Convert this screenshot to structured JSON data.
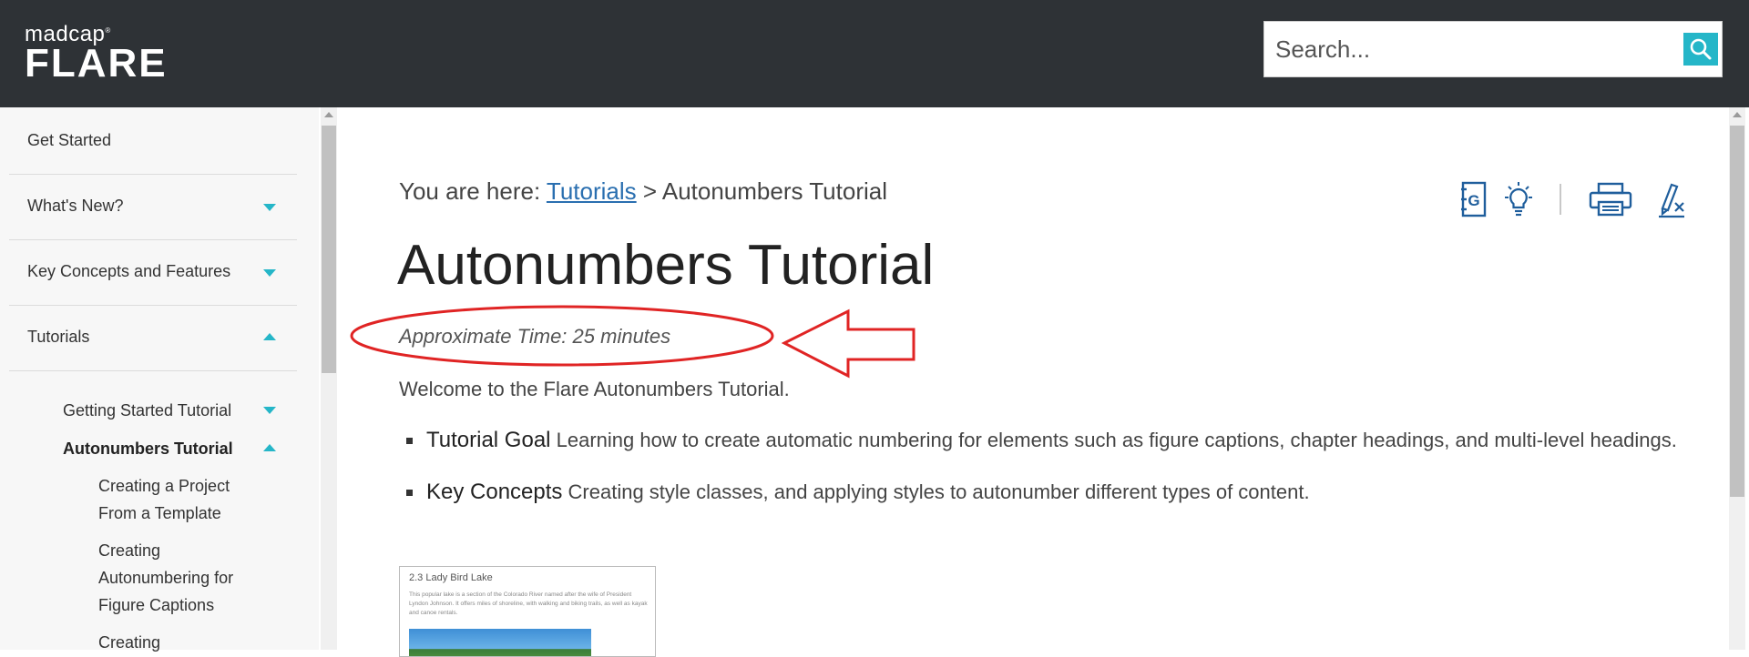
{
  "header": {
    "logo_top": "madcap",
    "logo_reg": "®",
    "logo_bottom": "FLARE",
    "search_placeholder": "Search..."
  },
  "sidebar": {
    "items": [
      {
        "label": "Get Started",
        "expandable": false
      },
      {
        "label": "What's New?",
        "expandable": true,
        "expanded": false
      },
      {
        "label": "Key Concepts and Features",
        "expandable": true,
        "expanded": false
      },
      {
        "label": "Tutorials",
        "expandable": true,
        "expanded": true
      }
    ],
    "subitems": [
      {
        "label": "Getting Started Tutorial",
        "expanded": false
      },
      {
        "label": "Autonumbers Tutorial",
        "expanded": true,
        "active": true
      }
    ],
    "subsubitems": [
      {
        "label_line1": "Creating a Project",
        "label_line2": "From a Template"
      },
      {
        "label_line1": "Creating",
        "label_line2": "Autonumbering for",
        "label_line3": "Figure Captions"
      },
      {
        "label_line1": "Creating"
      }
    ]
  },
  "breadcrumb": {
    "prefix": "You are here: ",
    "link": "Tutorials",
    "separator": " > ",
    "current": "Autonumbers Tutorial"
  },
  "page": {
    "title": "Autonumbers Tutorial",
    "approx_time": "Approximate Time: 25 minutes",
    "welcome": "Welcome to the Flare Autonumbers Tutorial.",
    "bullets": [
      {
        "term": "Tutorial Goal",
        "text": " Learning how to create automatic numbering for elements such as figure captions, chapter headings, and multi-level headings."
      },
      {
        "term": "Key Concepts",
        "text": " Creating style classes, and applying styles to autonumber different types of content."
      }
    ],
    "thumbnail": {
      "caption": "2.3  Lady Bird Lake",
      "text": "This popular lake is a section of the Colorado River named after the wife of President Lyndon Johnson. It offers miles of shoreline, with walking and biking trails, as well as kayak and canoe rentals."
    }
  },
  "toolbar": {
    "icons": [
      "glossary-icon",
      "lightbulb-icon",
      "print-icon",
      "clear-highlight-icon"
    ],
    "glossary_letter": "G"
  },
  "colors": {
    "header_bg": "#2e3236",
    "accent": "#25b6c8",
    "link": "#2a6fb0",
    "icon_blue": "#1f5e9c",
    "annotation_red": "#e02424"
  }
}
